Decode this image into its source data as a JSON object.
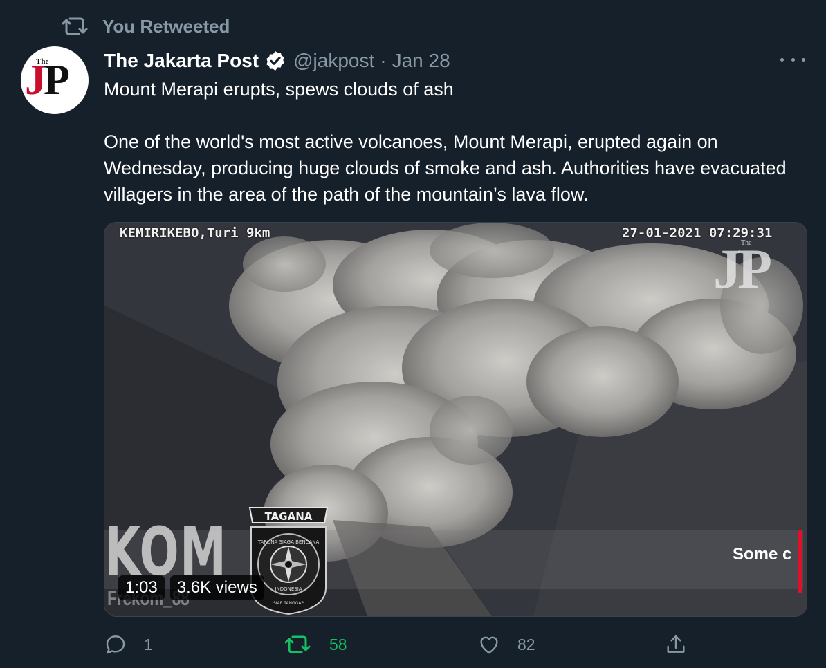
{
  "retweet_context": {
    "icon": "retweet-icon",
    "label": "You Retweeted"
  },
  "author": {
    "display_name": "The Jakarta Post",
    "verified": true,
    "handle": "@jakpost",
    "separator": "·",
    "date": "Jan 28",
    "avatar_logo": {
      "small_word": "The",
      "j": "J",
      "p": "P"
    }
  },
  "tweet": {
    "headline": "Mount Merapi erupts, spews clouds of ash",
    "body": "One of the world's most active volcanoes, Mount Merapi, erupted again on Wednesday, producing huge clouds of smoke and ash. Authorities have evacuated villagers in the area of the path of the mountain’s lava flow."
  },
  "media": {
    "type": "video",
    "duration": "1:03",
    "views": "3.6K views",
    "overlay": {
      "location": "KEMIRIKEBO,Turi 9km",
      "timestamp": "27-01-2021 07:29:31",
      "watermark_small": "The",
      "watermark": "JP",
      "side_text": "KOM",
      "bottom_text": "Frekom_88",
      "logo_top": "TAGANA",
      "logo_ring_top": "TARUNA SIAGA BENCANA",
      "logo_ring_bottom": "INDONESIA",
      "logo_motto": "SIAP TANGGAP",
      "caption_partial": "Some c"
    }
  },
  "actions": {
    "reply_count": "1",
    "retweet_count": "58",
    "like_count": "82",
    "retweeted": true,
    "retweet_color": "#17bf63"
  },
  "colors": {
    "background": "#15202b",
    "secondary_text": "#8899a6",
    "primary_text": "#ffffff",
    "accent_green": "#17bf63"
  }
}
